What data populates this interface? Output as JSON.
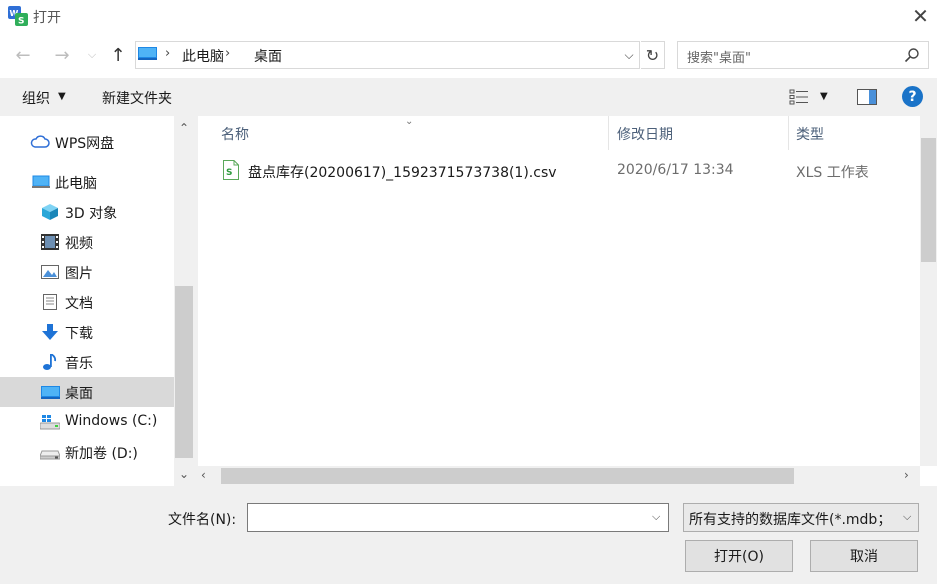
{
  "window": {
    "title": "打开"
  },
  "navigation": {
    "breadcrumb": [
      "此电脑",
      "桌面"
    ],
    "search_placeholder": "搜索\"桌面\""
  },
  "toolbar": {
    "organize_label": "组织",
    "new_folder_label": "新建文件夹"
  },
  "sidebar": {
    "items": [
      {
        "label": "WPS网盘",
        "icon": "cloud-icon"
      },
      {
        "label": "此电脑",
        "icon": "computer-icon"
      },
      {
        "label": "3D 对象",
        "icon": "cube-icon"
      },
      {
        "label": "视频",
        "icon": "video-icon"
      },
      {
        "label": "图片",
        "icon": "picture-icon"
      },
      {
        "label": "文档",
        "icon": "document-icon"
      },
      {
        "label": "下载",
        "icon": "download-icon"
      },
      {
        "label": "音乐",
        "icon": "music-icon"
      },
      {
        "label": "桌面",
        "icon": "desktop-icon",
        "selected": true
      },
      {
        "label": "Windows (C:)",
        "icon": "windows-drive-icon"
      },
      {
        "label": "新加卷 (D:)",
        "icon": "drive-icon"
      }
    ]
  },
  "file_list": {
    "columns": [
      "名称",
      "修改日期",
      "类型"
    ],
    "rows": [
      {
        "name": "盘点库存(20200617)_1592371573738(1).csv",
        "modified": "2020/6/17 13:34",
        "type": "XLS 工作表"
      }
    ]
  },
  "bottom": {
    "filename_label": "文件名(N):",
    "filename_value": "",
    "filetype_selected": "所有支持的数据库文件(*.mdb；",
    "open_label": "打开(O)",
    "cancel_label": "取消"
  },
  "colors": {
    "accent": "#1a73c8",
    "selection": "#d9d9d9"
  }
}
